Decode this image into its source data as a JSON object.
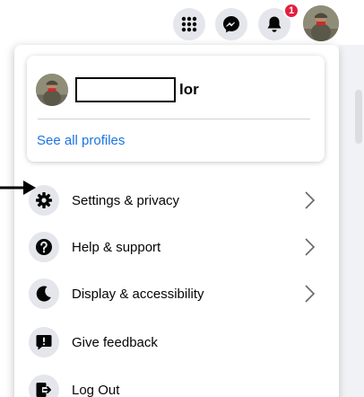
{
  "header": {
    "menu_icon": "grid-icon",
    "messenger_icon": "messenger-icon",
    "notifications_icon": "bell-icon",
    "notification_count": "1"
  },
  "profile": {
    "name_visible_suffix": "lor",
    "see_all_label": "See all profiles"
  },
  "menu": [
    {
      "label": "Settings & privacy",
      "icon": "gear-icon",
      "has_chevron": true
    },
    {
      "label": "Help & support",
      "icon": "question-icon",
      "has_chevron": true
    },
    {
      "label": "Display & accessibility",
      "icon": "moon-icon",
      "has_chevron": true
    },
    {
      "label": "Give feedback",
      "icon": "feedback-icon",
      "has_chevron": false
    },
    {
      "label": "Log Out",
      "icon": "logout-icon",
      "has_chevron": false
    }
  ],
  "colors": {
    "link": "#1b74e4",
    "icon_bg": "#e4e6eb",
    "badge": "#e41e3f"
  }
}
